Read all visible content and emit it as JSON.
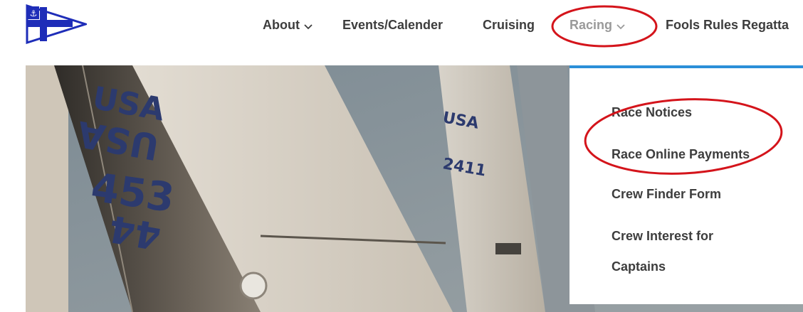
{
  "header": {
    "logo": {
      "name": "club-burgee-logo"
    },
    "nav": [
      {
        "label": "About",
        "has_dropdown": true
      },
      {
        "label": "Events/Calender",
        "has_dropdown": false
      },
      {
        "label": "Cruising",
        "has_dropdown": false
      },
      {
        "label": "Racing",
        "has_dropdown": true,
        "active": true
      },
      {
        "label": "Fools Rules Regatta",
        "has_dropdown": false
      }
    ]
  },
  "racing_dropdown": {
    "items": [
      {
        "label": "Race Notices"
      },
      {
        "label": "Race Online Payments"
      },
      {
        "label": "Crew Finder Form"
      },
      {
        "label": "Crew Interest for"
      },
      {
        "label": "Captains"
      }
    ]
  },
  "hero": {
    "sail_numbers": [
      "USA",
      "453",
      "44",
      "USA",
      "2411"
    ]
  },
  "colors": {
    "nav_text": "#3d3d3d",
    "nav_active": "#9a9a9a",
    "dropdown_accent": "#2b8fd8",
    "annotation_red": "#d4141b",
    "logo_blue": "#1e2db8"
  }
}
